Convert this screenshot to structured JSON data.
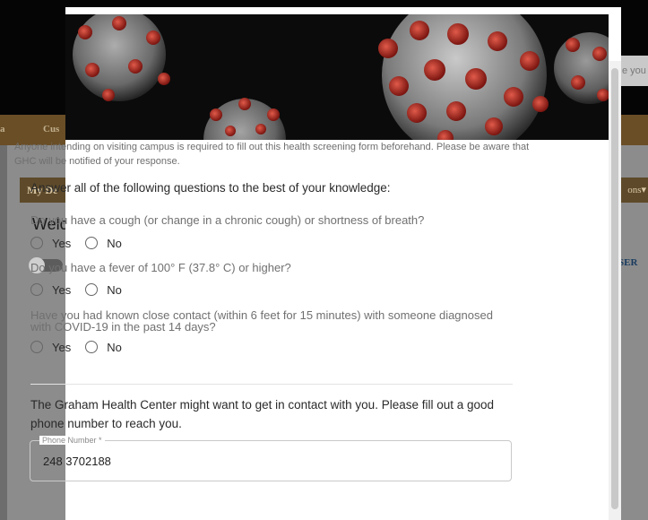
{
  "background": {
    "search_partial": "e you",
    "nav_left_partial": "a",
    "nav_partial": "Cus",
    "mydesk_partial": "My De",
    "options_partial": "ons▾",
    "welcome_partial": "Welc",
    "user_partial": "SER"
  },
  "modal": {
    "intro": "Anyone intending on visiting campus is required to fill out this health screening form beforehand. Please be aware that GHC will be notified of your response.",
    "heading": "Answer all of the following questions to the best of your knowledge:",
    "questions": [
      {
        "text": "Do you have a cough (or change in a chronic cough) or shortness of breath?",
        "options": [
          "Yes",
          "No"
        ]
      },
      {
        "text": "Do you have a fever of 100° F (37.8° C) or higher?",
        "options": [
          "Yes",
          "No"
        ]
      },
      {
        "text": "Have you had known close contact (within 6 feet for 15 minutes) with someone diagnosed with COVID-19 in the past 14 days?",
        "options": [
          "Yes",
          "No"
        ]
      }
    ],
    "contact_text": "The Graham Health Center might want to get in contact with you. Please fill out a good phone number to reach you.",
    "phone": {
      "label": "Phone Number *",
      "value": "248 3702188"
    }
  }
}
